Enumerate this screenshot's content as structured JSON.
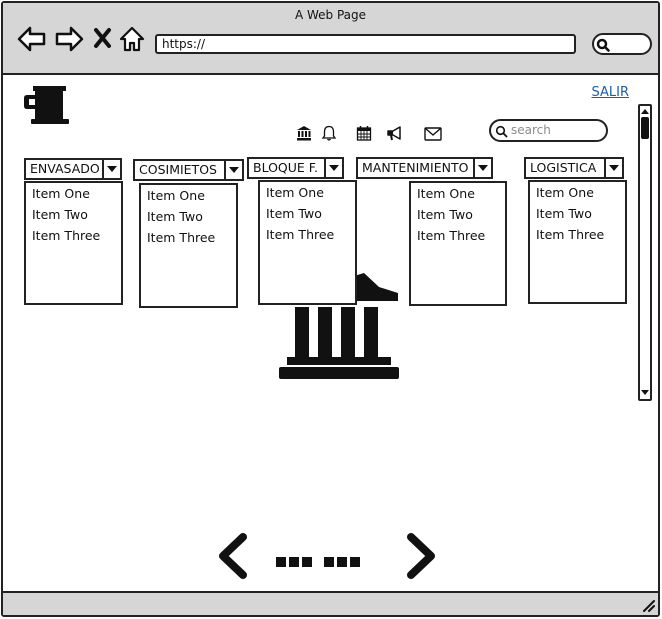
{
  "browser": {
    "title": "A Web Page",
    "url": "https://"
  },
  "header": {
    "logout_label": "SALIR",
    "search_placeholder": "search",
    "icons": [
      "bank-icon",
      "bell-icon",
      "calendar-icon",
      "megaphone-icon",
      "envelope-icon"
    ]
  },
  "menus": [
    {
      "label": "ENVASADO",
      "items": [
        "Item One",
        "Item Two",
        "Item Three"
      ]
    },
    {
      "label": "COSIMIETOS",
      "items": [
        "Item One",
        "Item Two",
        "Item Three"
      ]
    },
    {
      "label": "BLOQUE F.",
      "items": [
        "Item One",
        "Item Two",
        "Item Three"
      ]
    },
    {
      "label": "MANTENIMIENTO",
      "items": [
        "Item One",
        "Item Two",
        "Item Three"
      ]
    },
    {
      "label": "LOGISTICA",
      "items": [
        "Item One",
        "Item Two",
        "Item Three"
      ]
    }
  ],
  "colors": {
    "chrome": "#d6d6d6",
    "link": "#1a5fa8",
    "border": "#222222"
  }
}
